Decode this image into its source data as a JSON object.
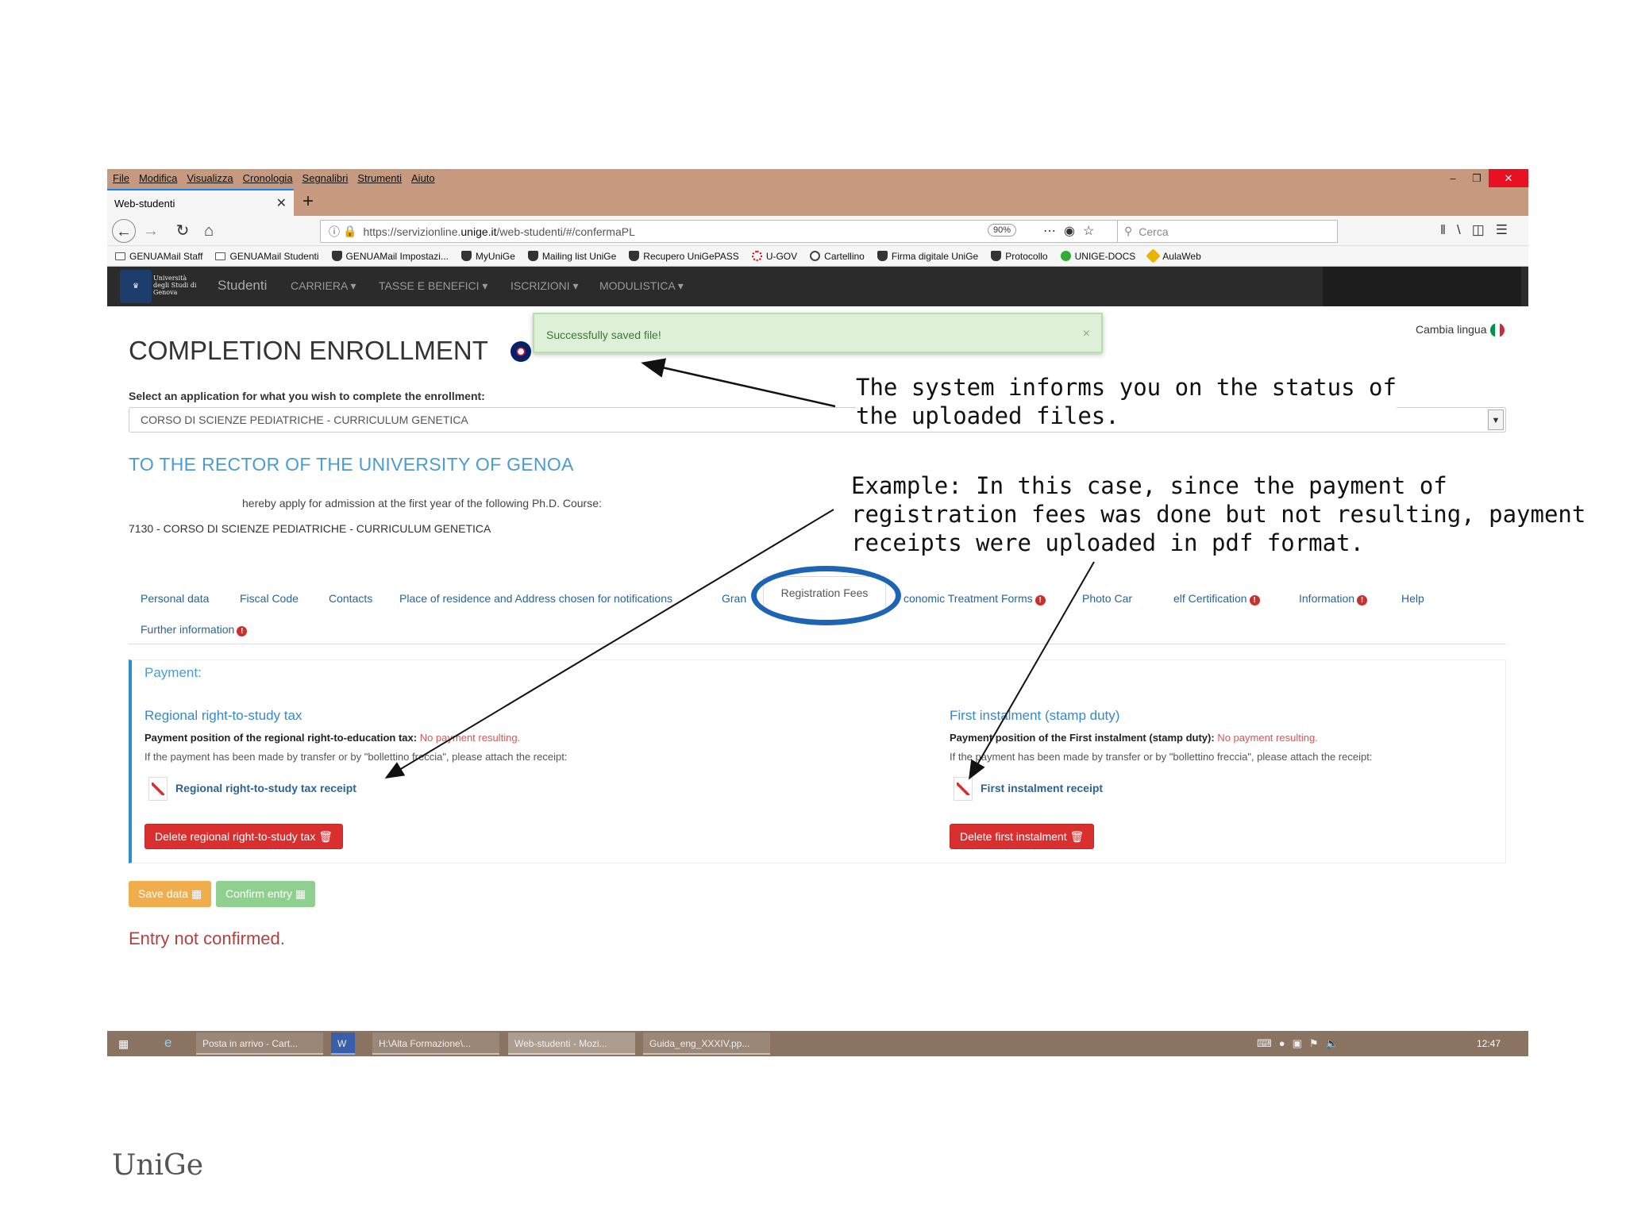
{
  "browser": {
    "menu": [
      "File",
      "Modifica",
      "Visualizza",
      "Cronologia",
      "Segnalibri",
      "Strumenti",
      "Aiuto"
    ],
    "tab_title": "Web-studenti",
    "new_tab": "+",
    "url_prefix": "https://servizionline.",
    "url_host": "unige.it",
    "url_path": "/web-studenti/#/confermaPL",
    "zoom": "90%",
    "search_placeholder": "Cerca",
    "bookmarks": [
      "GENUAMail Staff",
      "GENUAMail Studenti",
      "GENUAMail Impostazi...",
      "MyUniGe",
      "Mailing list UniGe",
      "Recupero UniGePASS",
      "U-GOV",
      "Cartellino",
      "Firma digitale UniGe",
      "Protocollo",
      "UNIGE-DOCS",
      "AulaWeb"
    ]
  },
  "app": {
    "brand": "Studenti",
    "logo_text": "Università degli Studi di Genova",
    "menu": [
      "CARRIERA ▾",
      "TASSE E BENEFICI ▾",
      "ISCRIZIONI ▾",
      "MODULISTICA ▾"
    ]
  },
  "page": {
    "title": "COMPLETION ENROLLMENT",
    "toast": "Successfully saved file!",
    "toast_close": "×",
    "lang": "Cambia lingua",
    "select_label": "Select an application for what you wish to complete the enrollment:",
    "select_value": "CORSO DI SCIENZE PEDIATRICHE - CURRICULUM GENETICA",
    "rector": "TO THE RECTOR OF THE UNIVERSITY OF GENOA",
    "apply_text": "hereby apply for admission at the first year of the following Ph.D. Course:",
    "course_code": "7130 - CORSO DI SCIENZE PEDIATRICHE - CURRICULUM GENETICA"
  },
  "tabs": {
    "personal": "Personal data",
    "fiscal": "Fiscal Code",
    "contacts": "Contacts",
    "residence": "Place of residence and Address chosen for notifications",
    "gran": "Gran",
    "registration": "Registration Fees",
    "economic": "conomic Treatment Forms",
    "photo": "Photo Car",
    "self_cert": "elf Certification",
    "information": "Information",
    "help": "Help",
    "further": "Further information"
  },
  "payment": {
    "title": "Payment:",
    "regional": {
      "title": "Regional right-to-study tax",
      "position_label": "Payment position of the regional right-to-education tax:",
      "status": "No payment resulting.",
      "note": "If the payment has been made by transfer or by \"bollettino freccia\", please attach the receipt:",
      "receipt": "Regional right-to-study tax receipt",
      "delete": "Delete regional right-to-study tax"
    },
    "first": {
      "title": "First instalment (stamp duty)",
      "position_label": "Payment position of the First instalment (stamp duty):",
      "status": "No payment resulting.",
      "note": "If the payment has been made by transfer or by \"bollettino freccia\", please attach the receipt:",
      "receipt": "First instalment receipt",
      "delete": "Delete first instalment"
    }
  },
  "actions": {
    "save": "Save data",
    "confirm": "Confirm entry",
    "status": "Entry not confirmed."
  },
  "taskbar": {
    "items": [
      "Posta in arrivo - Cart...",
      "",
      "H:\\Alta Formazione\\...",
      "Web-studenti - Mozi...",
      "Guida_eng_XXXIV.pp..."
    ],
    "clock": "12:47"
  },
  "annotations": {
    "callout1": [
      "The system informs you on the status of",
      "the uploaded files."
    ],
    "callout2": [
      "Example: In this case, since the payment of",
      "registration fees was done but not resulting, payment",
      "receipts were uploaded in pdf format."
    ]
  },
  "footer": "UniGe",
  "colors": {
    "accent": "#4a9cd0",
    "danger": "#d9302f",
    "success_bg": "#dff0d8",
    "highlight": "#1e64b4",
    "chrome": "#c79a7f"
  }
}
